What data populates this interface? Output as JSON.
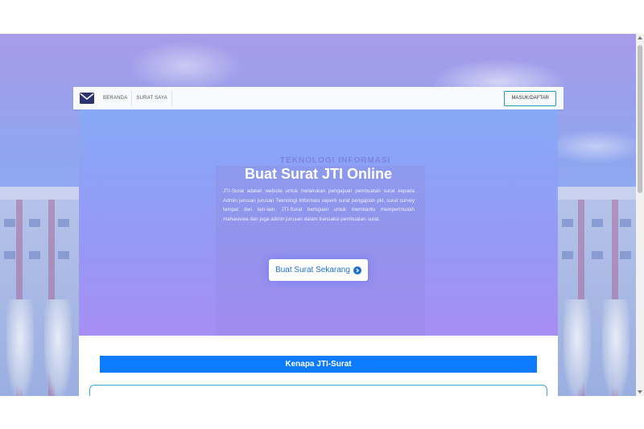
{
  "navbar": {
    "brand_icon": "envelope-icon",
    "items": [
      {
        "label": "BERANDA"
      },
      {
        "label": "SURAT SAYA"
      }
    ],
    "login_label": "MASUK/DAFTAR"
  },
  "hero": {
    "title": "Buat Surat JTI Online",
    "description": "JTI-Surat adalah website untuk melakukan pengajuan pembuatan surat kepada Admin jurusan jurusan Teknologi Informasi seperti surat pengajuan pkl, surat survey tempat dan lain-lain. JTI-Surat bertujuan untuk membantu mempermudah mahasiswa dan juga admin jurusan dalam transaksi pembuatan surat.",
    "background_sign": "TEKNOLOGI INFORMASI",
    "cta_label": "Buat Surat Sekarang",
    "cta_icon": "chevron-right-circle-icon"
  },
  "section": {
    "title": "Kenapa JTI-Surat"
  },
  "colors": {
    "primary": "#0d7bfd",
    "navbar_bg": "#f8f9fa",
    "outline": "#17a2b8",
    "cta_text": "#1f6fd1"
  }
}
